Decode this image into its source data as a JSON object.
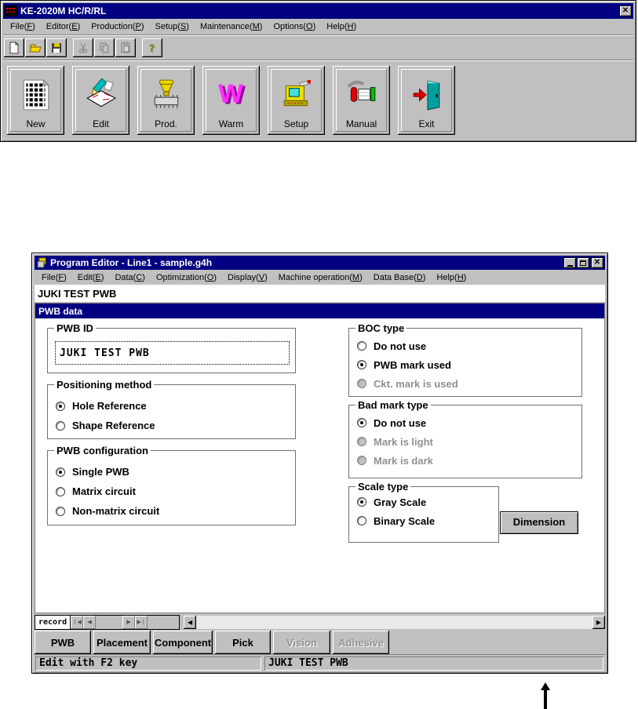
{
  "colors": {
    "titlebar": "#000080",
    "window_face": "#c0c0c0",
    "disabled_text": "#909090",
    "content_bg": "#ffffff"
  },
  "launcher": {
    "title": "KE-2020M HC/R/RL",
    "menu": [
      "File(F)",
      "Editor(E)",
      "Production(P)",
      "Setup(S)",
      "Maintenance(M)",
      "Options(O)",
      "Help(H)"
    ],
    "toolbar_icons": [
      "new-file-icon",
      "open-folder-icon",
      "save-icon",
      "cut-icon",
      "copy-icon",
      "paste-icon",
      "help-icon"
    ],
    "big_buttons": [
      {
        "label": "New",
        "icon": "new-grid-icon"
      },
      {
        "label": "Edit",
        "icon": "edit-pencil-icon"
      },
      {
        "label": "Prod.",
        "icon": "production-nozzle-icon"
      },
      {
        "label": "Warm",
        "icon": "warm-w-icon"
      },
      {
        "label": "Setup",
        "icon": "setup-machine-icon"
      },
      {
        "label": "Manual",
        "icon": "manual-tools-icon"
      },
      {
        "label": "Exit",
        "icon": "exit-door-icon"
      }
    ]
  },
  "editor": {
    "title": "Program Editor - Line1 - sample.g4h",
    "menu": [
      "File(F)",
      "Edit(E)",
      "Data(C)",
      "Optimization(O)",
      "Display(V)",
      "Machine operation(M)",
      "Data Base(D)",
      "Help(H)"
    ],
    "heading": "JUKI TEST PWB",
    "panel_title": "PWB data",
    "groups": {
      "pwb_id": {
        "label": "PWB ID",
        "value": "JUKI TEST PWB"
      },
      "positioning": {
        "label": "Positioning method",
        "options": [
          {
            "label": "Hole Reference",
            "checked": true
          },
          {
            "label": "Shape Reference",
            "checked": false
          }
        ]
      },
      "configuration": {
        "label": "PWB configuration",
        "options": [
          {
            "label": "Single PWB",
            "checked": true
          },
          {
            "label": "Matrix circuit",
            "checked": false
          },
          {
            "label": "Non-matrix circuit",
            "checked": false
          }
        ]
      },
      "boc": {
        "label": "BOC type",
        "options": [
          {
            "label": "Do not use",
            "checked": false
          },
          {
            "label": "PWB mark used",
            "checked": true
          },
          {
            "label": "Ckt. mark is used",
            "checked": false,
            "disabled": true
          }
        ]
      },
      "bad_mark": {
        "label": "Bad mark type",
        "options": [
          {
            "label": "Do not use",
            "checked": true
          },
          {
            "label": "Mark is light",
            "checked": false,
            "disabled": true
          },
          {
            "label": "Mark is dark",
            "checked": false,
            "disabled": true
          }
        ]
      },
      "scale": {
        "label": "Scale type",
        "options": [
          {
            "label": "Gray Scale",
            "checked": true
          },
          {
            "label": "Binary Scale",
            "checked": false
          }
        ]
      }
    },
    "dimension_button": "Dimension",
    "record_label": "record",
    "tabs": [
      {
        "label": "PWB",
        "disabled": false
      },
      {
        "label": "Placement",
        "disabled": false
      },
      {
        "label": "Component",
        "disabled": false
      },
      {
        "label": "Pick",
        "disabled": false
      },
      {
        "label": "Vision",
        "disabled": true
      },
      {
        "label": "Adhesive",
        "disabled": true
      }
    ],
    "status_left": "Edit with F2 key",
    "status_right": "JUKI TEST PWB"
  }
}
